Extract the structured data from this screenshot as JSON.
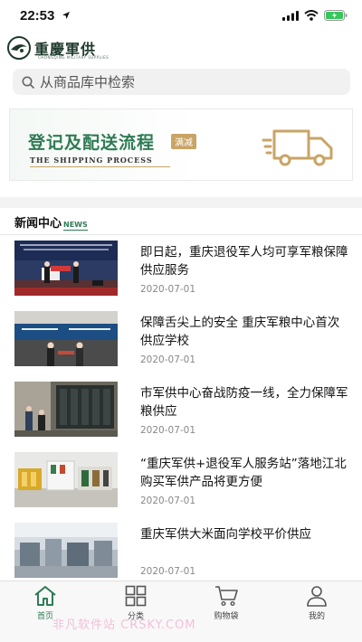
{
  "status_bar": {
    "time": "22:53"
  },
  "header": {
    "logo_text": "重慶軍供",
    "logo_subtitle": "CHONGQING MILITARY SUPPLIES"
  },
  "search": {
    "placeholder": "从商品库中检索"
  },
  "banner": {
    "title": "登记及配送流程",
    "tag": "满减",
    "subtitle": "THE SHIPPING PROCESS"
  },
  "news_section": {
    "title": "新闻中心",
    "title_en": "NEWS",
    "items": [
      {
        "title": "即日起，重庆退役军人均可享军粮保障供应服务",
        "date": "2020-07-01"
      },
      {
        "title": "保障舌尖上的安全 重庆军粮中心首次供应学校",
        "date": "2020-07-01"
      },
      {
        "title": "市军供中心奋战防疫一线，全力保障军粮供应",
        "date": "2020-07-01"
      },
      {
        "title": "“重庆军供+退役军人服务站”落地江北 购买军供产品将更方便",
        "date": "2020-07-01"
      },
      {
        "title": "重庆军供大米面向学校平价供应",
        "date": "2020-07-01"
      }
    ]
  },
  "tabbar": {
    "tabs": [
      {
        "label": "首页",
        "icon": "home-icon"
      },
      {
        "label": "分类",
        "icon": "grid-icon"
      },
      {
        "label": "购物袋",
        "icon": "cart-icon"
      },
      {
        "label": "我的",
        "icon": "user-icon"
      }
    ]
  },
  "watermark": "非凡软件站 CRSKY.COM",
  "colors": {
    "accent": "#2e7b54",
    "gold": "#c9a466"
  }
}
